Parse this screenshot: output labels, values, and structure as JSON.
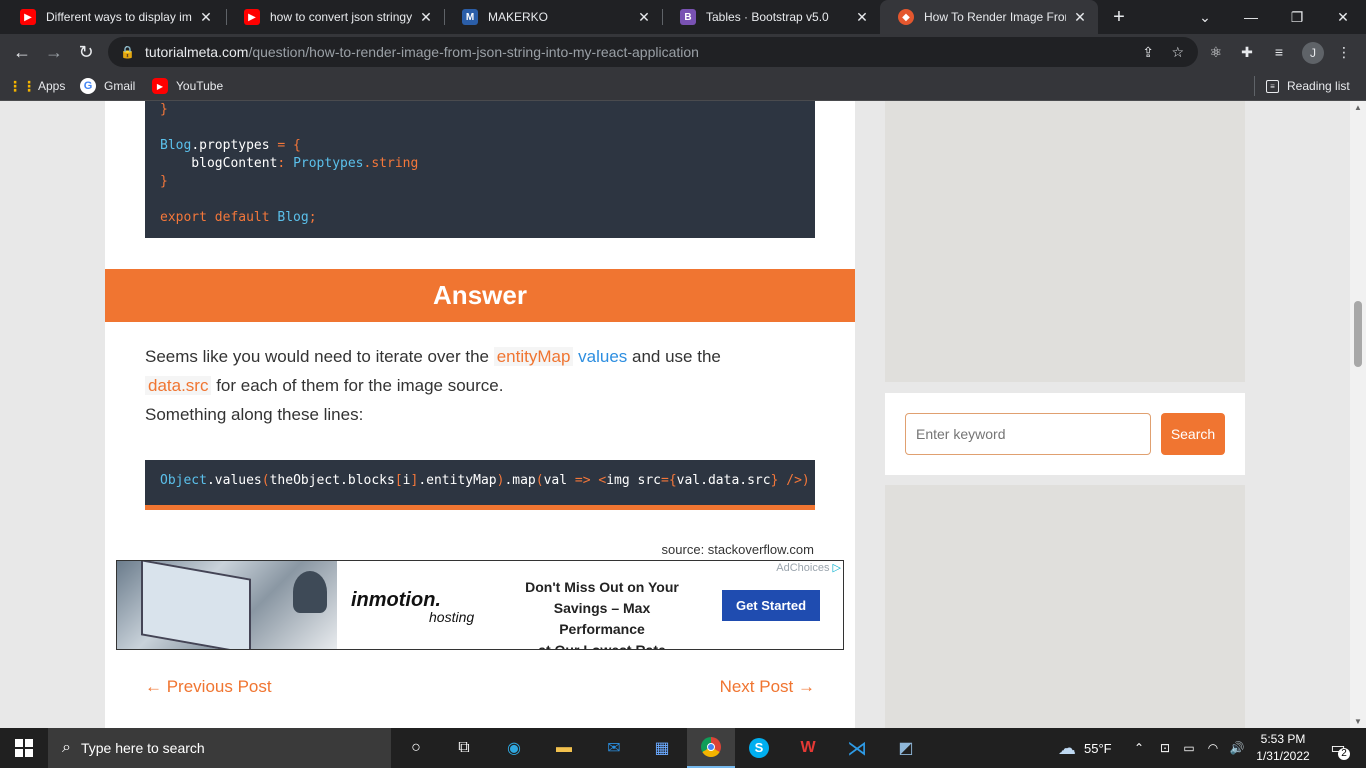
{
  "browser": {
    "tabs": [
      {
        "title": "Different ways to display ima",
        "icon": "youtube-icon"
      },
      {
        "title": "how to convert json stringy t",
        "icon": "youtube-icon"
      },
      {
        "title": "MAKERKO",
        "icon": "makerko-icon"
      },
      {
        "title": "Tables · Bootstrap v5.0",
        "icon": "bootstrap-icon"
      },
      {
        "title": "How To Render Image From",
        "icon": "tutorialmeta-icon",
        "active": true
      }
    ],
    "new_tab": "+",
    "url_host": "tutorialmeta.com",
    "url_path": "/question/how-to-render-image-from-json-string-into-my-react-application",
    "profile_initial": "J",
    "bookmarks": [
      {
        "label": "Apps"
      },
      {
        "label": "Gmail"
      },
      {
        "label": "YouTube"
      }
    ],
    "reading_list": "Reading list"
  },
  "code_block_1": {
    "lines": [
      [
        {
          "t": "}",
          "c": "kw"
        }
      ],
      [],
      [
        {
          "t": "Blog",
          "c": "cy"
        },
        {
          "t": ".proptypes ",
          "c": "pl"
        },
        {
          "t": "= {",
          "c": "kw"
        }
      ],
      [
        {
          "t": "    blogContent",
          "c": "pl"
        },
        {
          "t": ": ",
          "c": "kw"
        },
        {
          "t": "Proptypes",
          "c": "cy"
        },
        {
          "t": ".string",
          "c": "kw"
        }
      ],
      [
        {
          "t": "}",
          "c": "kw"
        }
      ],
      [],
      [
        {
          "t": "export default ",
          "c": "kw"
        },
        {
          "t": "Blog",
          "c": "cy"
        },
        {
          "t": ";",
          "c": "kw"
        }
      ]
    ]
  },
  "answer": {
    "heading": "Answer",
    "p1_a": "Seems like you would need to iterate over the ",
    "p1_tag1": "entityMap",
    "p1_blue": " values",
    "p1_b": " and use the",
    "p1_tag2": "data.src",
    "p1_c": " for each of them for the image source.",
    "p2": "Something along these lines:"
  },
  "code_block_2": {
    "segments": [
      {
        "t": "Object",
        "c": "cy"
      },
      {
        "t": ".values",
        "c": "pl"
      },
      {
        "t": "(",
        "c": "kw"
      },
      {
        "t": "theObject",
        "c": "pl"
      },
      {
        "t": ".blocks",
        "c": "pl"
      },
      {
        "t": "[",
        "c": "kw"
      },
      {
        "t": "i",
        "c": "pl"
      },
      {
        "t": "]",
        "c": "kw"
      },
      {
        "t": ".entityMap",
        "c": "pl"
      },
      {
        "t": ")",
        "c": "kw"
      },
      {
        "t": ".map",
        "c": "pl"
      },
      {
        "t": "(",
        "c": "kw"
      },
      {
        "t": "val ",
        "c": "pl"
      },
      {
        "t": "=> <",
        "c": "kw"
      },
      {
        "t": "img ",
        "c": "pl"
      },
      {
        "t": "src",
        "c": "pl"
      },
      {
        "t": "={",
        "c": "kw"
      },
      {
        "t": "val",
        "c": "pl"
      },
      {
        "t": ".data.src",
        "c": "pl"
      },
      {
        "t": "} />)",
        "c": "kw"
      }
    ]
  },
  "source": "source: stackoverflow.com",
  "ad": {
    "adchoices": "AdChoices",
    "brand": "inmotion.",
    "brand_sub": "hosting",
    "line1": "Don't Miss Out on Your",
    "line2": "Savings – Max Performance",
    "line3": "at Our Lowest Rate",
    "cta": "Get Started"
  },
  "pager": {
    "prev": "← Previous Post",
    "next": "Next Post →"
  },
  "sidebar": {
    "search_placeholder": "Enter keyword",
    "search_button": "Search"
  },
  "taskbar": {
    "search_placeholder": "Type here to search",
    "weather": "55°F",
    "time": "5:53 PM",
    "date": "1/31/2022",
    "notifications": "2"
  },
  "colors": {
    "accent": "#f07531",
    "code_bg": "#2d3541",
    "link_blue": "#2d8ee0"
  }
}
